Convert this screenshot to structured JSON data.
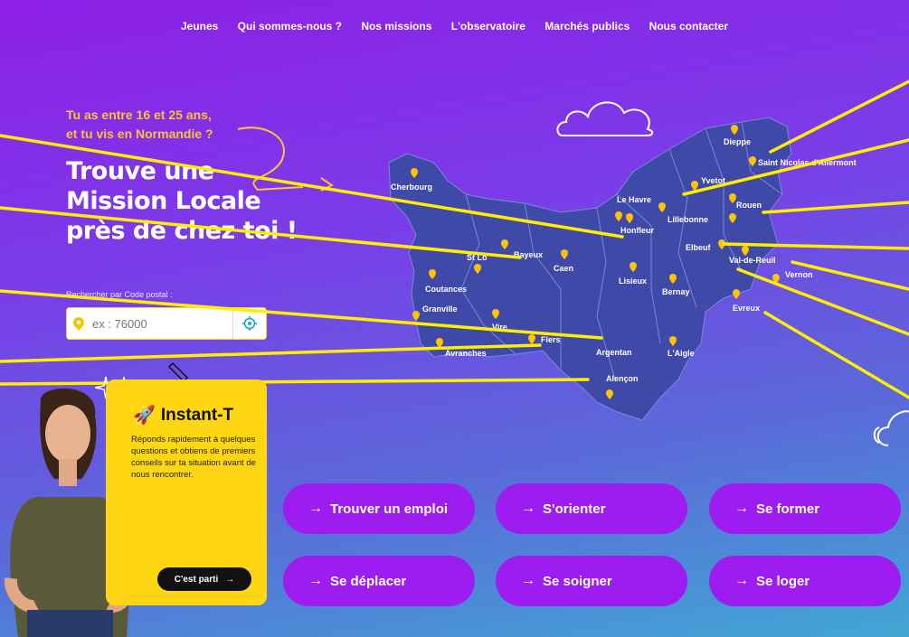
{
  "nav": [
    "Jeunes",
    "Qui sommes-nous ?",
    "Nos missions",
    "L'observatoire",
    "Marchés publics",
    "Nous contacter"
  ],
  "hero": {
    "tagline_1": "Tu as entre 16 et 25 ans,",
    "tagline_2": "et tu vis en Normandie ?",
    "headline_1": "Trouve une",
    "headline_2": "Mission Locale",
    "headline_3": "près de chez toi !",
    "search_label": "Rechercher par Code postal :",
    "search_placeholder": "ex : 76000"
  },
  "cities": [
    "Dieppe",
    "Saint Nicolas d'Aliermont",
    "Yvetot",
    "Le Havre",
    "Lillebonne",
    "Rouen",
    "Cherbourg",
    "Honfleur",
    "Elbeuf",
    "Val-de-Reuil",
    "Vernon",
    "Bayeux",
    "Caen",
    "St Lô",
    "Lisieux",
    "Bernay",
    "Coutances",
    "Evreux",
    "Granville",
    "Vire",
    "Flers",
    "Argentan",
    "L'Aigle",
    "Avranches",
    "Alençon"
  ],
  "card": {
    "title": "Instant-T",
    "description": "Réponds rapidement à quelques questions et obtiens de premiers conseils sur ta situation avant de nous rencontrer.",
    "cta": "C'est parti"
  },
  "buttons": [
    "Trouver un emploi",
    "S'orienter",
    "Se former",
    "Se déplacer",
    "Se soigner",
    "Se loger"
  ],
  "colors": {
    "accent_yellow": "#ffd614",
    "button_purple": "#9d1cf0",
    "map_fill": "#3f4aa8"
  }
}
